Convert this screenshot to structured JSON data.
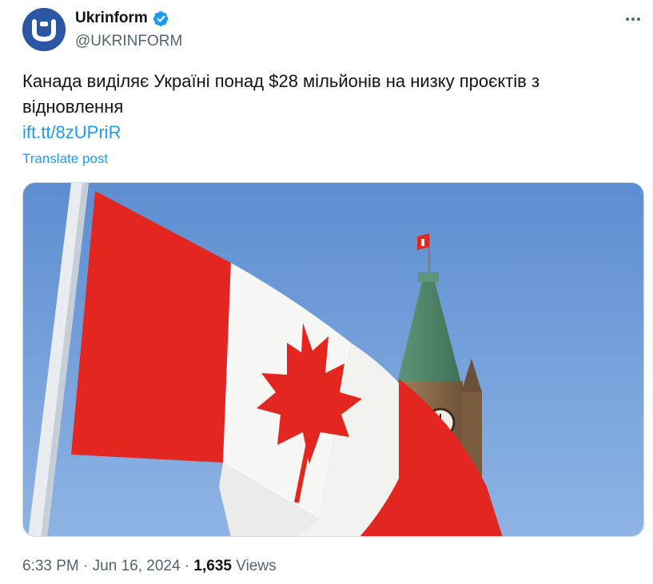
{
  "author": {
    "display_name": "Ukrinform",
    "handle": "@UKRINFORM",
    "avatar_letter": "U",
    "verified": true,
    "verified_color": "#1d9bf0",
    "avatar_color": "#2b56a3"
  },
  "post": {
    "text": "Канада виділяє Україні понад $28 мільйонів на низку проєктів з відновлення",
    "link_text": "ift.tt/8zUPriR",
    "translate_label": "Translate post"
  },
  "media": {
    "icons": [
      "canada-flag",
      "peace-tower",
      "clock"
    ]
  },
  "meta": {
    "time": "6:33 PM",
    "separator1": " · ",
    "date": "Jun 16, 2024",
    "separator2": " · ",
    "views_count": "1,635",
    "views_label": " Views"
  },
  "colors": {
    "link": "#1d9bf0",
    "secondary_text": "#536471",
    "primary_text": "#0f1419"
  },
  "icons": {
    "more": "more-horizontal-icon",
    "verified": "verified-badge-icon"
  }
}
